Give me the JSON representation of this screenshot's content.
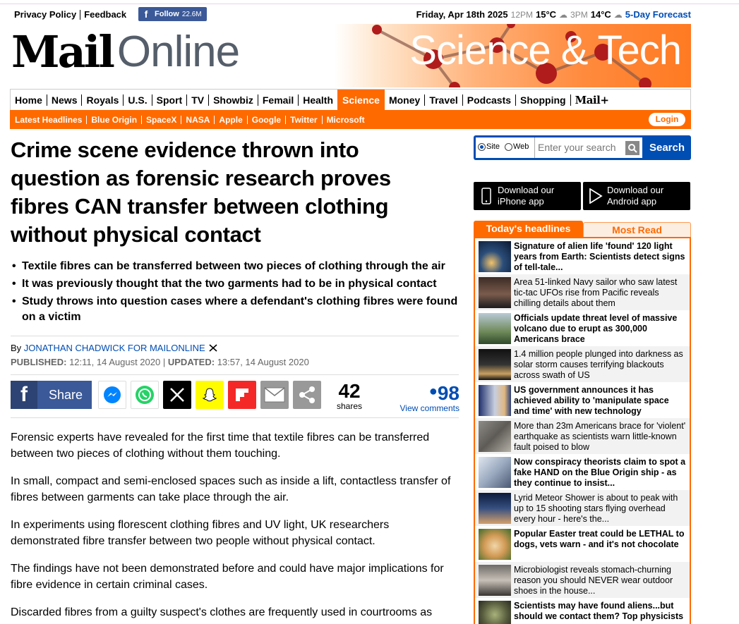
{
  "topbar": {
    "privacy": "Privacy Policy",
    "feedback": "Feedback",
    "follow_label": "Follow",
    "follow_count": "22.6M",
    "date": "Friday, Apr 18th 2025",
    "t1": "12PM",
    "temp1": "15°C",
    "t2": "3PM",
    "temp2": "14°C",
    "forecast": "5-Day Forecast"
  },
  "masthead": {
    "logo_mail": "Mail",
    "logo_online": "Online",
    "section_title": "Science & Tech"
  },
  "nav": [
    "Home",
    "News",
    "Royals",
    "U.S.",
    "Sport",
    "TV",
    "Showbiz",
    "Femail",
    "Health",
    "Science",
    "Money",
    "Travel",
    "Podcasts",
    "Shopping",
    "Mail+"
  ],
  "nav_active": "Science",
  "subnav": [
    "Latest Headlines",
    "Blue Origin",
    "SpaceX",
    "NASA",
    "Apple",
    "Google",
    "Twitter",
    "Microsoft"
  ],
  "login": "Login",
  "article": {
    "headline": "Crime scene evidence thrown into question as forensic research proves fibres CAN transfer between clothing without physical contact",
    "bullets": [
      "Textile fibres can be transferred between two pieces of clothing through the air",
      "It was previously thought that the two garments had to be in physical contact",
      "Study throws into question cases where a defendant's clothing fibres were found on a victim"
    ],
    "by": "By",
    "author": "JONATHAN CHADWICK FOR MAILONLINE",
    "published_label": "PUBLISHED:",
    "published": "12:11, 14 August 2020",
    "updated_label": "UPDATED:",
    "updated": "13:57, 14 August 2020",
    "share_label": "Share",
    "shares_count": "42",
    "shares_label": "shares",
    "comments_count": "98",
    "comments_label": "View comments",
    "paragraphs": [
      "Forensic experts have revealed for the first time that textile fibres can be transferred between two pieces of clothing without them touching.",
      "In small, compact and semi-enclosed spaces such as inside a lift, contactless transfer of fibres between garments can take place through the air.",
      "In experiments using florescent clothing fibres and UV light, UK researchers demonstrated fibre transfer between two people without physical contact.",
      "The findings have not been demonstrated before and could have major implications for fibre evidence in certain criminal cases.",
      "Discarded fibres from a guilty suspect's clothes are frequently used in courtrooms as"
    ]
  },
  "sidebar": {
    "search": {
      "site": "Site",
      "web": "Web",
      "placeholder": "Enter your search",
      "button": "Search"
    },
    "iphone": [
      "Download our",
      "iPhone app"
    ],
    "android": [
      "Download our",
      "Android app"
    ],
    "tab_today": "Today's headlines",
    "tab_most": "Most Read",
    "headlines": [
      {
        "text": "Signature of alien life 'found' 120 light years from Earth: Scientists detect signs of tell-tale...",
        "bold": true
      },
      {
        "text": "Area 51-linked Navy sailor who saw latest tic-tac UFOs rise from Pacific reveals chilling details about them",
        "bold": false
      },
      {
        "text": "Officials update threat level of massive volcano due to erupt as 300,000 Americans brace",
        "bold": true
      },
      {
        "text": "1.4 million people plunged into darkness as solar storm causes terrifying blackouts across swath of US",
        "bold": false
      },
      {
        "text": "US government announces it has achieved ability to 'manipulate space and time' with new technology",
        "bold": true
      },
      {
        "text": "More than 23m Americans brace for 'violent' earthquake as scientists warn little-known fault poised to blow",
        "bold": false
      },
      {
        "text": "Now conspiracy theorists claim to spot a fake HAND on the Blue Origin ship - as they continue to insist...",
        "bold": true
      },
      {
        "text": "Lyrid Meteor Shower is about to peak with up to 15 shooting stars flying overhead every hour - here's the...",
        "bold": false
      },
      {
        "text": "Popular Easter treat could be LETHAL to dogs, vets warn - and it's not chocolate",
        "bold": true
      },
      {
        "text": "Microbiologist reveals stomach-churning reason you should NEVER wear outdoor shoes in the house...",
        "bold": false
      },
      {
        "text": "Scientists may have found aliens...but should we contact them? Top physicists",
        "bold": true
      }
    ]
  },
  "colors": {
    "brand_orange": "#ff6a00",
    "link_blue": "#004db3",
    "facebook_blue": "#3b5998"
  }
}
